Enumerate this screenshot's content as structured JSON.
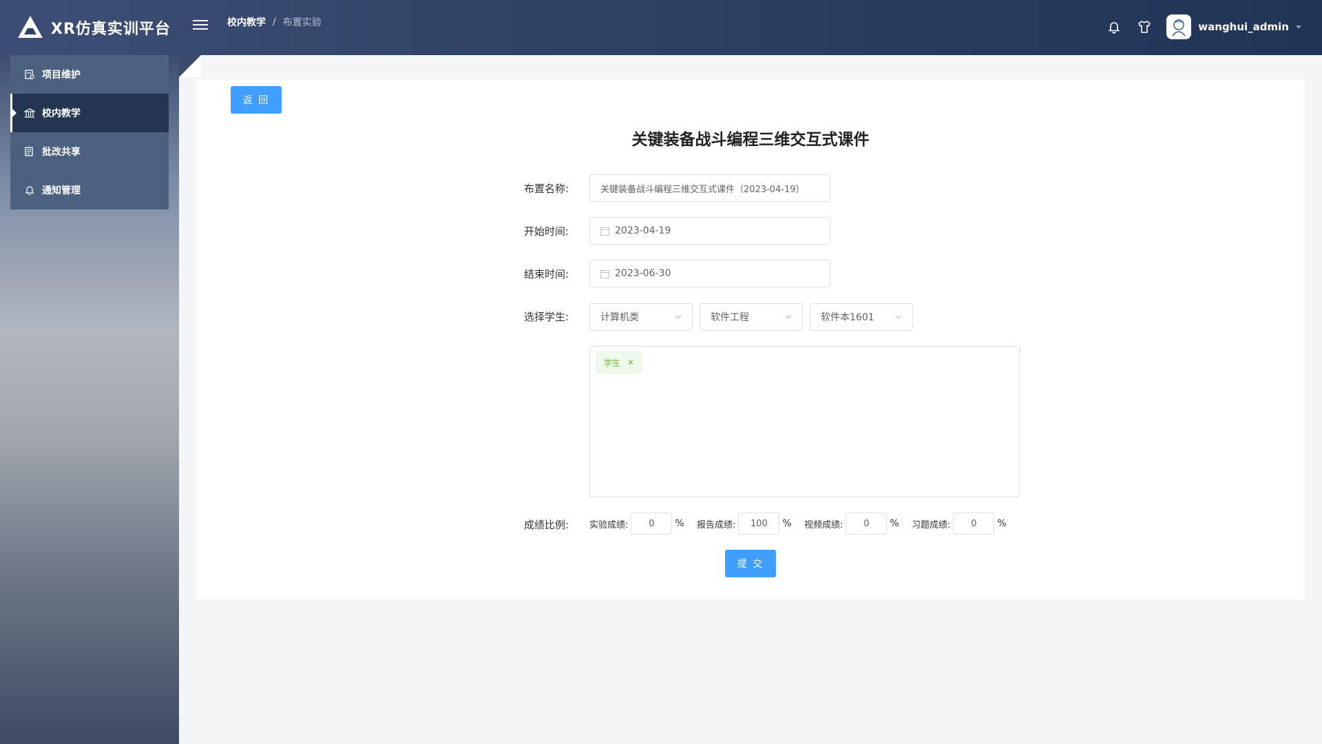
{
  "header": {
    "app_title": "XR仿真实训平台",
    "breadcrumb": [
      "校内教学",
      "/",
      "布置实验"
    ],
    "username": "wanghui_admin"
  },
  "icons": {
    "logo": "triangle-logo-icon",
    "menu": "hamburger-icon",
    "notifications": "bell-icon",
    "theme": "tshirt-icon",
    "avatar": "user-avatar-icon"
  },
  "sidebar": {
    "items": [
      {
        "label": "项目维护",
        "icon": "project-icon",
        "active": false
      },
      {
        "label": "校内教学",
        "icon": "bank-icon",
        "active": true
      },
      {
        "label": "批改共享",
        "icon": "review-icon",
        "active": false
      },
      {
        "label": "通知管理",
        "icon": "bell-icon",
        "active": false
      }
    ]
  },
  "main": {
    "back_label": "返 回",
    "title": "关键装备战斗编程三维交互式课件",
    "form": {
      "name_label": "布置名称:",
      "name_value": "关键装备战斗编程三维交互式课件（2023-04-19）",
      "start_label": "开始时间:",
      "start_value": "2023-04-19",
      "end_label": "结束时间:",
      "end_value": "2023-06-30",
      "student_label": "选择学生:",
      "selects": [
        "计算机类",
        "软件工程",
        "软件本1601"
      ],
      "selected_tag": "学生",
      "ratio_label": "成绩比例:",
      "scores": [
        {
          "label": "实验成绩:",
          "value": "0",
          "unit": "%"
        },
        {
          "label": "报告成绩:",
          "value": "100",
          "unit": "%"
        },
        {
          "label": "视频成绩:",
          "value": "0",
          "unit": "%"
        },
        {
          "label": "习题成绩:",
          "value": "0",
          "unit": "%"
        }
      ]
    },
    "submit_label": "提 交"
  },
  "colors": {
    "primary": "#409eff",
    "header_bg": "#2f4366",
    "sidebar_active": "#243552",
    "tag_green": "#67c23a"
  }
}
